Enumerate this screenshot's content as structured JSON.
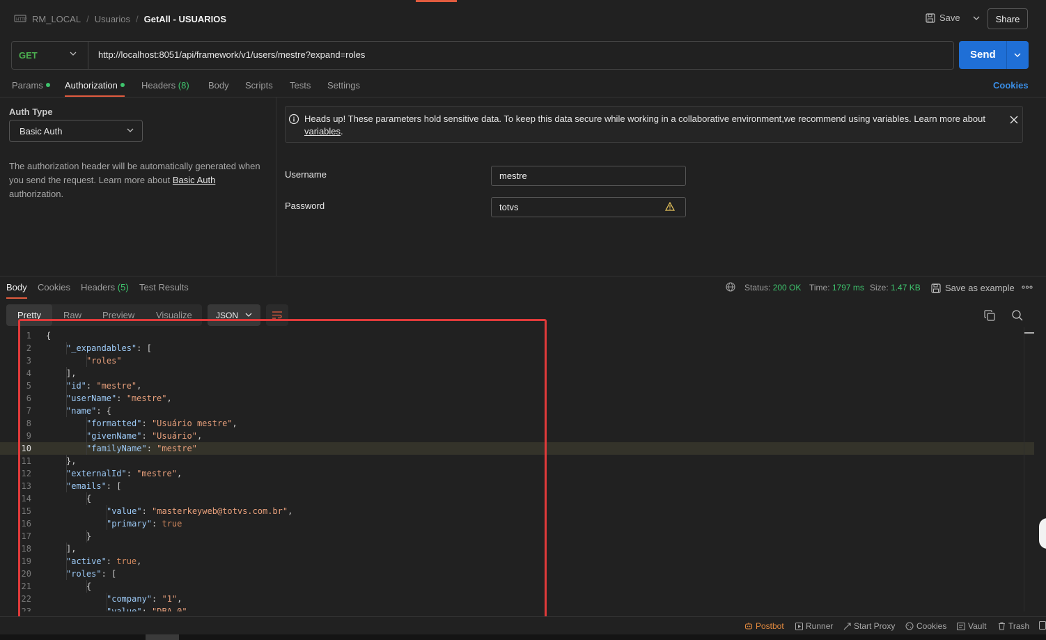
{
  "breadcrumb": {
    "items": [
      "RM_LOCAL",
      "Usuarios"
    ],
    "current": "GetAll - USUARIOS"
  },
  "header": {
    "save_label": "Save",
    "share_label": "Share"
  },
  "request": {
    "method": "GET",
    "url": "http://localhost:8051/api/framework/v1/users/mestre?expand=roles",
    "send_label": "Send"
  },
  "request_tabs": {
    "params": "Params",
    "authorization": "Authorization",
    "headers": "Headers",
    "headers_count": "(8)",
    "body": "Body",
    "scripts": "Scripts",
    "tests": "Tests",
    "settings": "Settings",
    "cookies": "Cookies"
  },
  "auth": {
    "type_label": "Auth Type",
    "type_value": "Basic Auth",
    "description_pre": "The authorization header will be automatically generated when you send the request. Learn more about ",
    "description_link": "Basic Auth",
    "description_post": " authorization.",
    "notice_text": "Heads up! These parameters hold sensitive data. To keep this data secure while working in a collaborative environment,we recommend using variables. Learn more about ",
    "notice_link": "variables",
    "notice_end": ".",
    "username_label": "Username",
    "username_value": "mestre",
    "password_label": "Password",
    "password_value": "totvs"
  },
  "response_tabs": {
    "body": "Body",
    "cookies": "Cookies",
    "headers": "Headers",
    "headers_count": "(5)",
    "test_results": "Test Results"
  },
  "response_meta": {
    "status_label": "Status:",
    "status_value": "200 OK",
    "time_label": "Time:",
    "time_value": "1797 ms",
    "size_label": "Size:",
    "size_value": "1.47 KB",
    "save_example": "Save as example"
  },
  "format_tabs": [
    "Pretty",
    "Raw",
    "Preview",
    "Visualize"
  ],
  "format_type": "JSON",
  "code_lines": [
    [
      [
        "p",
        "{"
      ]
    ],
    [
      [
        "k",
        "\"_expandables\""
      ],
      [
        "p",
        ": ["
      ]
    ],
    [
      [
        "s",
        "\"roles\""
      ]
    ],
    [
      [
        "p",
        "],"
      ]
    ],
    [
      [
        "k",
        "\"id\""
      ],
      [
        "p",
        ": "
      ],
      [
        "s",
        "\"mestre\""
      ],
      [
        "p",
        ","
      ]
    ],
    [
      [
        "k",
        "\"userName\""
      ],
      [
        "p",
        ": "
      ],
      [
        "s",
        "\"mestre\""
      ],
      [
        "p",
        ","
      ]
    ],
    [
      [
        "k",
        "\"name\""
      ],
      [
        "p",
        ": {"
      ]
    ],
    [
      [
        "k",
        "\"formatted\""
      ],
      [
        "p",
        ": "
      ],
      [
        "s",
        "\"Usuário mestre\""
      ],
      [
        "p",
        ","
      ]
    ],
    [
      [
        "k",
        "\"givenName\""
      ],
      [
        "p",
        ": "
      ],
      [
        "s",
        "\"Usuário\""
      ],
      [
        "p",
        ","
      ]
    ],
    [
      [
        "k",
        "\"familyName\""
      ],
      [
        "p",
        ": "
      ],
      [
        "s",
        "\"mestre\""
      ]
    ],
    [
      [
        "p",
        "},"
      ]
    ],
    [
      [
        "k",
        "\"externalId\""
      ],
      [
        "p",
        ": "
      ],
      [
        "s",
        "\"mestre\""
      ],
      [
        "p",
        ","
      ]
    ],
    [
      [
        "k",
        "\"emails\""
      ],
      [
        "p",
        ": ["
      ]
    ],
    [
      [
        "p",
        "{"
      ]
    ],
    [
      [
        "k",
        "\"value\""
      ],
      [
        "p",
        ": "
      ],
      [
        "s",
        "\"masterkeyweb@totvs.com.br\""
      ],
      [
        "p",
        ","
      ]
    ],
    [
      [
        "k",
        "\"primary\""
      ],
      [
        "p",
        ": "
      ],
      [
        "b",
        "true"
      ]
    ],
    [
      [
        "p",
        "}"
      ]
    ],
    [
      [
        "p",
        "],"
      ]
    ],
    [
      [
        "k",
        "\"active\""
      ],
      [
        "p",
        ": "
      ],
      [
        "b",
        "true"
      ],
      [
        "p",
        ","
      ]
    ],
    [
      [
        "k",
        "\"roles\""
      ],
      [
        "p",
        ": ["
      ]
    ],
    [
      [
        "p",
        "{"
      ]
    ],
    [
      [
        "k",
        "\"company\""
      ],
      [
        "p",
        ": "
      ],
      [
        "s",
        "\"1\""
      ],
      [
        "p",
        ","
      ]
    ],
    [
      [
        "k",
        "\"value\""
      ],
      [
        "p",
        ": "
      ],
      [
        "s",
        "\"DBA_0\""
      ],
      [
        "p",
        ","
      ]
    ]
  ],
  "code_indents": [
    0,
    1,
    2,
    1,
    1,
    1,
    1,
    2,
    2,
    2,
    1,
    1,
    1,
    2,
    3,
    3,
    2,
    1,
    1,
    1,
    2,
    3,
    3
  ],
  "highlighted_line": 10,
  "status_bar": [
    "Postbot",
    "Runner",
    "Start Proxy",
    "Cookies",
    "Vault",
    "Trash"
  ]
}
